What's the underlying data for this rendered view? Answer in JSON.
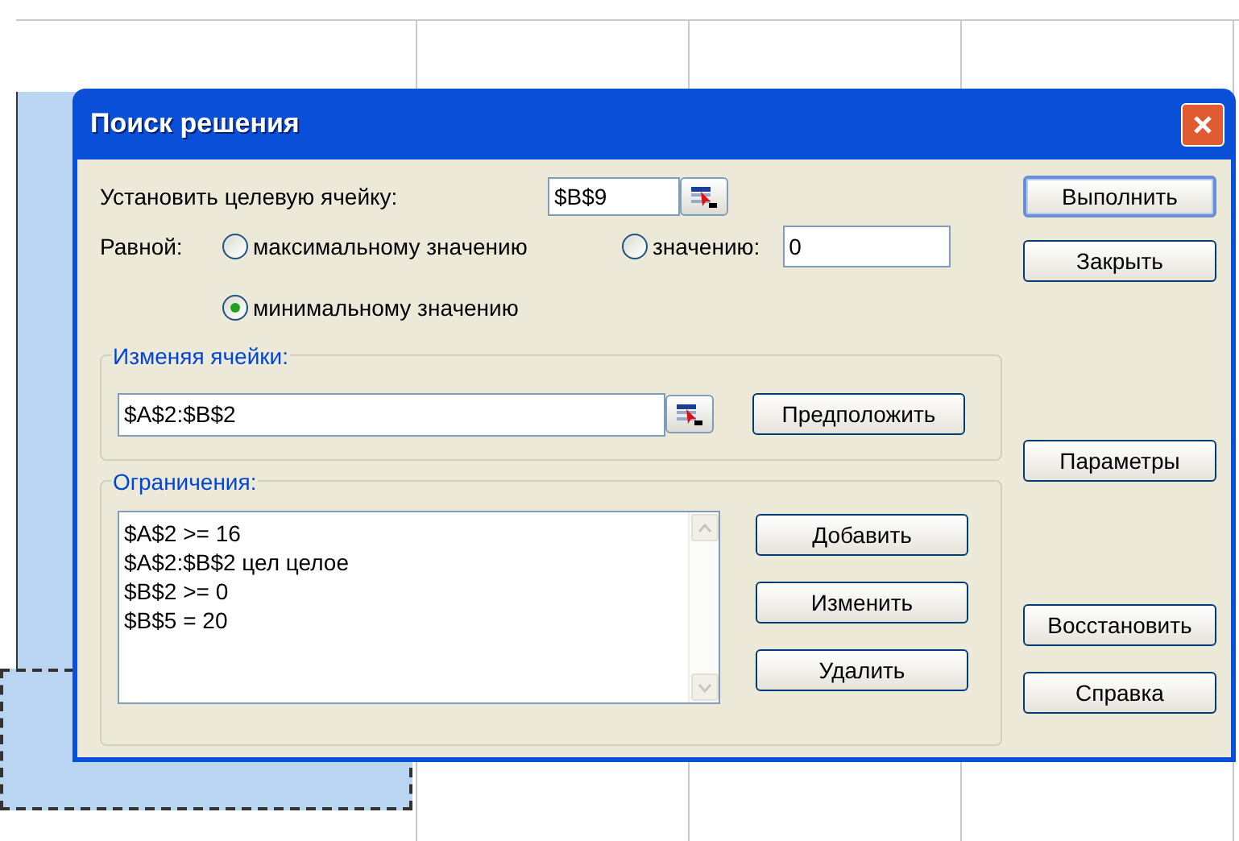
{
  "window": {
    "title": "Поиск решения"
  },
  "target": {
    "label": "Установить целевую ячейку:",
    "value": "$B$9"
  },
  "equal_to": {
    "label": "Равной:",
    "value": "0",
    "options": [
      {
        "label": "максимальному значению",
        "selected": false
      },
      {
        "label": "значению:",
        "selected": false
      },
      {
        "label": "минимальному значению",
        "selected": true
      }
    ]
  },
  "changing": {
    "label": "Изменяя ячейки:",
    "value": "$A$2:$B$2",
    "button": "Предположить"
  },
  "constraints": {
    "label": "Ограничения:",
    "items": [
      "$A$2 >= 16",
      "$A$2:$B$2 цел целое",
      "$B$2 >= 0",
      "$B$5 = 20"
    ],
    "buttons": [
      "Добавить",
      "Изменить",
      "Удалить"
    ]
  },
  "side_buttons": [
    {
      "label": "Выполнить",
      "default": true
    },
    {
      "label": "Закрыть",
      "default": false
    },
    {
      "label": "Параметры",
      "default": false
    },
    {
      "label": "Восстановить",
      "default": false
    },
    {
      "label": "Справка",
      "default": false
    }
  ]
}
